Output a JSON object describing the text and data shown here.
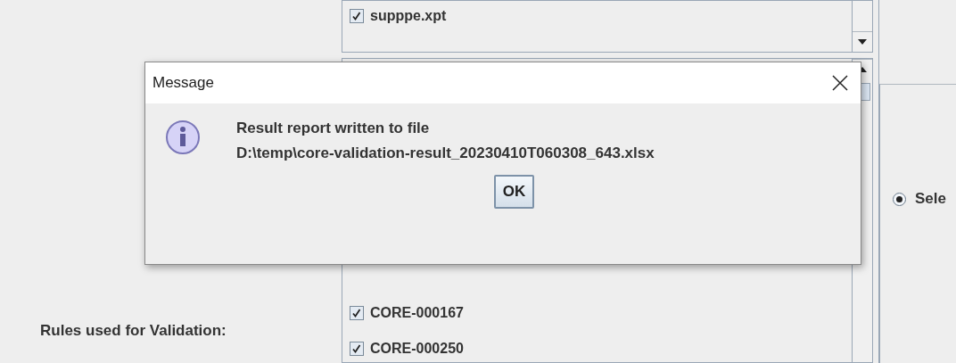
{
  "file_list": {
    "items": [
      {
        "label": "supppe.xpt",
        "checked": true
      }
    ]
  },
  "rules_label": "Rules used for Validation:",
  "rule_list": {
    "items": [
      {
        "label": "CORE-000167",
        "checked": true
      },
      {
        "label": "CORE-000250",
        "checked": true
      }
    ]
  },
  "options": [
    {
      "label": "Sele",
      "selected": true
    }
  ],
  "dialog": {
    "title": "Message",
    "lines": [
      "Result report written to file",
      "D:\\temp\\core-validation-result_20230410T060308_643.xlsx"
    ],
    "buttons": [
      "OK"
    ]
  }
}
